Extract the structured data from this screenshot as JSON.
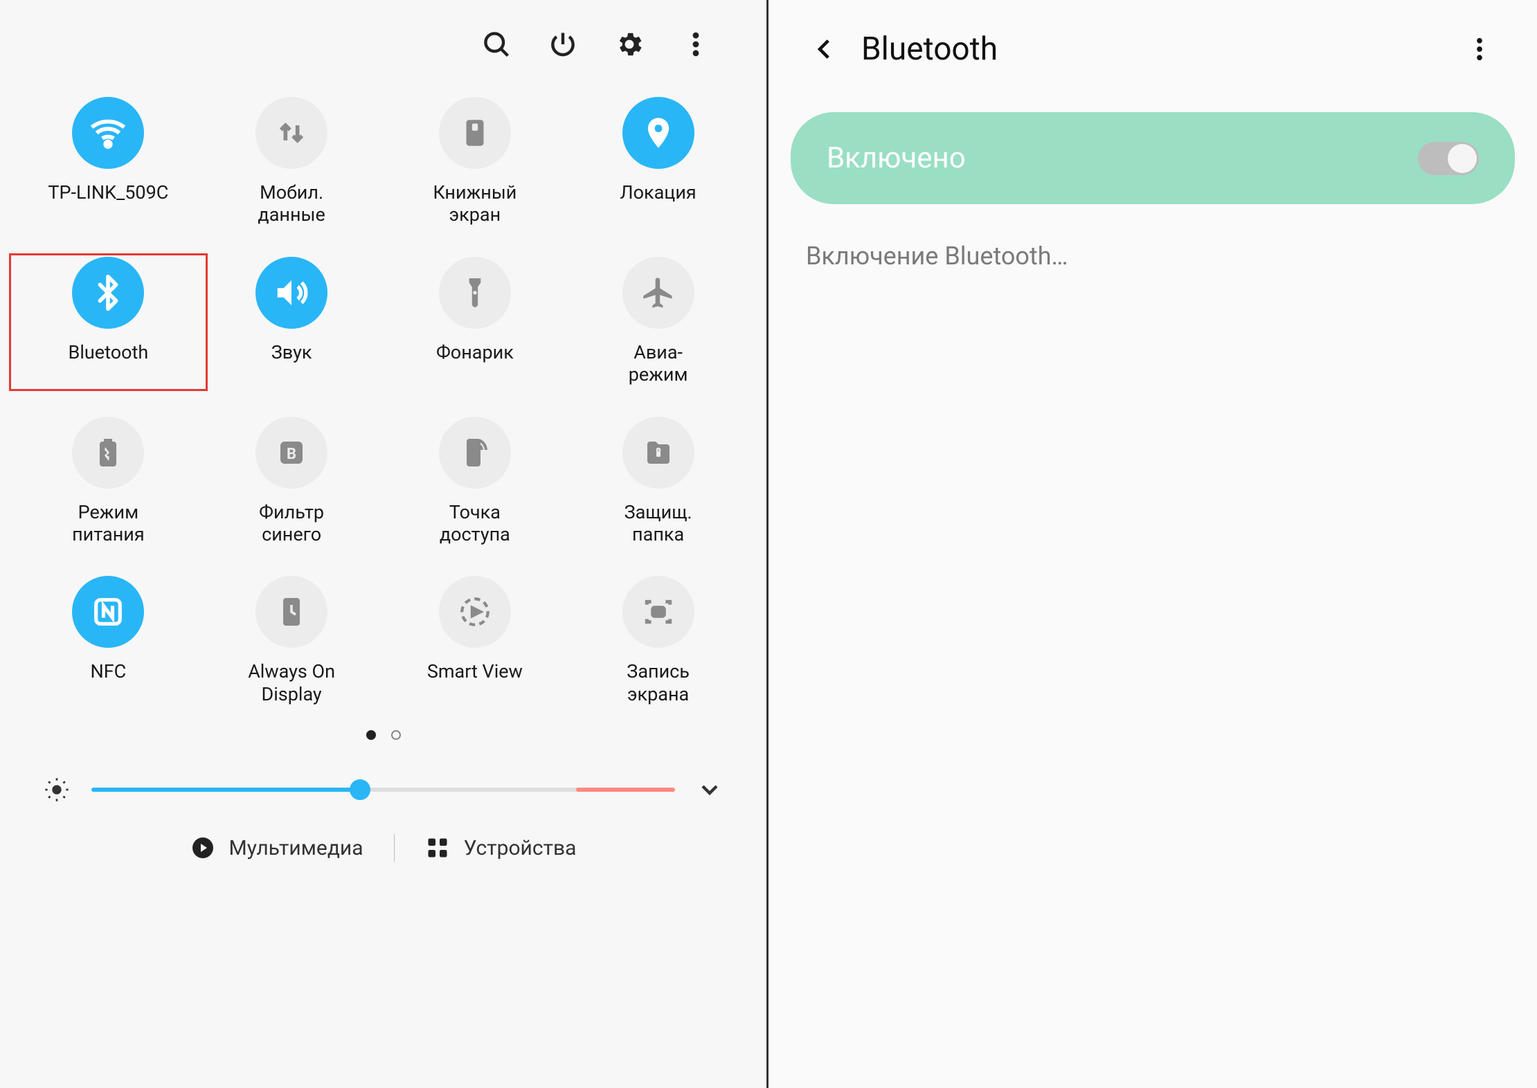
{
  "colors": {
    "accent": "#29b6f6",
    "accent_soft": "#9adfc3",
    "highlight": "#e53935"
  },
  "qs": {
    "brightness": {
      "value": 46,
      "max": 100,
      "auto_threshold": 83
    },
    "pager": {
      "pages": 2,
      "current": 0
    },
    "tiles": [
      {
        "id": "wifi",
        "label": "TP-LINK_509C",
        "on": true
      },
      {
        "id": "mobile-data",
        "label": "Мобил.\nданные",
        "on": false
      },
      {
        "id": "book-screen",
        "label": "Книжный\nэкран",
        "on": false
      },
      {
        "id": "location",
        "label": "Локация",
        "on": true
      },
      {
        "id": "bluetooth",
        "label": "Bluetooth",
        "on": true,
        "highlighted": true
      },
      {
        "id": "sound",
        "label": "Звук",
        "on": true
      },
      {
        "id": "flashlight",
        "label": "Фонарик",
        "on": false
      },
      {
        "id": "airplane",
        "label": "Авиа-\nрежим",
        "on": false
      },
      {
        "id": "power-mode",
        "label": "Режим\nпитания",
        "on": false
      },
      {
        "id": "blue-filter",
        "label": "Фильтр\nсинего",
        "on": false
      },
      {
        "id": "hotspot",
        "label": "Точка\nдоступа",
        "on": false
      },
      {
        "id": "secure-folder",
        "label": "Защищ.\nпапка",
        "on": false
      },
      {
        "id": "nfc",
        "label": "NFC",
        "on": true
      },
      {
        "id": "aod",
        "label": "Always On\nDisplay",
        "on": false
      },
      {
        "id": "smart-view",
        "label": "Smart View",
        "on": false
      },
      {
        "id": "screen-rec",
        "label": "Запись\nэкрана",
        "on": false
      }
    ],
    "bottom": {
      "multimedia": "Мультимедиа",
      "devices": "Устройства"
    }
  },
  "bt": {
    "title": "Bluetooth",
    "toggle_label": "Включено",
    "toggle_on": true,
    "status": "Включение Bluetooth…"
  }
}
